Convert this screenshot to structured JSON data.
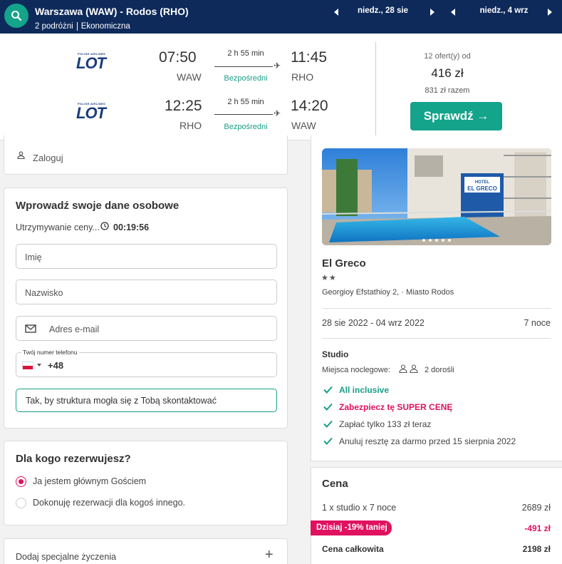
{
  "header": {
    "route": "Warszawa (WAW) - Rodos (RHO)",
    "travellers": "2 podróżni",
    "cabin": "Ekonomiczna",
    "depart_date": "niedz., 28 sie",
    "return_date": "niedz., 4 wrz"
  },
  "flights": {
    "airline": "LOT",
    "airline_small": "POLISH AIRLINES",
    "outbound": {
      "dep_time": "07:50",
      "dep_code": "WAW",
      "duration": "2 h 55 min",
      "stops": "Bezpośredni",
      "arr_time": "11:45",
      "arr_code": "RHO"
    },
    "inbound": {
      "dep_time": "12:25",
      "dep_code": "RHO",
      "duration": "2 h 55 min",
      "stops": "Bezpośredni",
      "arr_time": "14:20",
      "arr_code": "WAW"
    },
    "offers": "12 ofert(y) od",
    "price": "416 zł",
    "total": "831 zł razem",
    "check_label": "Sprawdź →"
  },
  "login": {
    "label": "Zaloguj"
  },
  "personal": {
    "title": "Wprowadź swoje dane osobowe",
    "hold_text": "Utrzymywanie ceny...",
    "timer": "00:19:56",
    "first_name_placeholder": "Imię",
    "last_name_placeholder": "Nazwisko",
    "email_placeholder": "Adres e-mail",
    "phone_label": "Twój numer telefonu",
    "phone_prefix": "+48",
    "hint": "Tak, by struktura mogła się z Tobą skontaktować"
  },
  "booking_for": {
    "title": "Dla kogo rezerwujesz?",
    "options": [
      {
        "label": "Ja jestem głównym Gościem",
        "selected": true
      },
      {
        "label": "Dokonuję rezerwacji dla kogoś innego.",
        "selected": false
      }
    ]
  },
  "special": {
    "label": "Dodaj specjalne życzenia",
    "plus": "+"
  },
  "hotel": {
    "name": "El Greco",
    "stars": 2,
    "stars_text": "★★",
    "address": "Georgioy Efstathioy 2, · Miasto Rodos",
    "sign_text": "HOTEL EL GRECO",
    "dates": "28 sie 2022 - 04 wrz 2022",
    "nights": "7 noce",
    "room": "Studio",
    "beds_label": "Miejsca noclegowe:",
    "adults": "2 dorośli",
    "features": [
      {
        "text": "All inclusive",
        "style": "green"
      },
      {
        "text": "Zabezpiecz tę SUPER CENĘ",
        "style": "pink"
      },
      {
        "text": "Zapłać tylko 133 zł teraz",
        "style": "gray"
      },
      {
        "text": "Anuluj resztę za darmo przed 15 sierpnia 2022",
        "style": "gray"
      }
    ]
  },
  "pricing": {
    "title": "Cena",
    "line_label": "1 x studio x 7 noce",
    "line_value": "2689 zł",
    "discount_label": "Dzisiaj -19% taniej",
    "discount_value": "-491 zł",
    "total_label": "Cena całkowita",
    "total_value": "2198 zł"
  },
  "colors": {
    "navy": "#0e2a5a",
    "teal": "#14a38b",
    "pink": "#e0115f"
  }
}
